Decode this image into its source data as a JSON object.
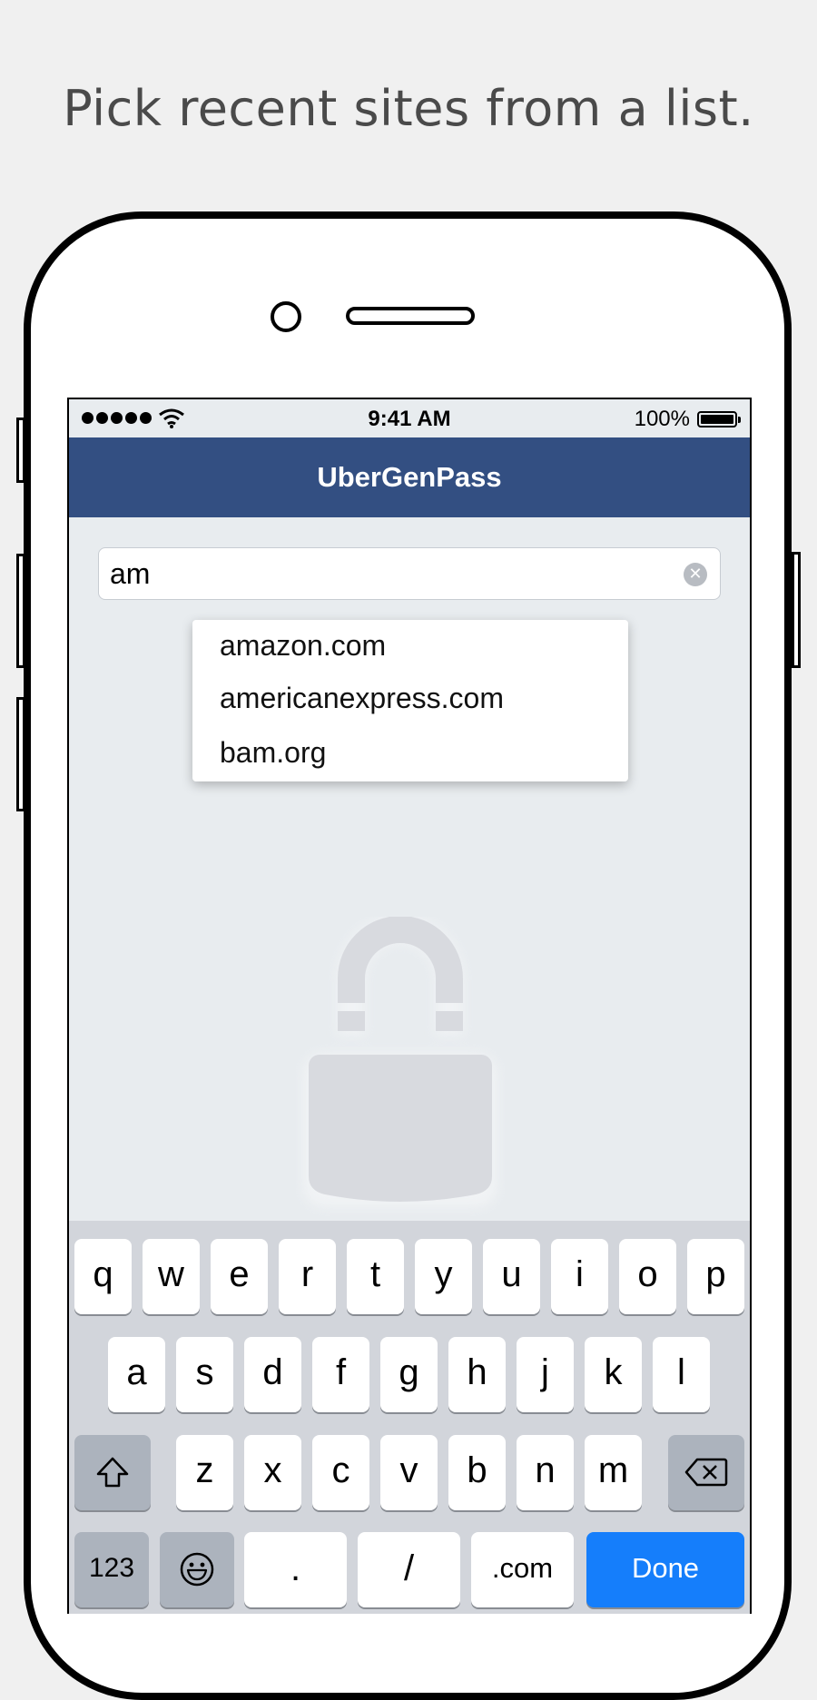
{
  "headline": "Pick recent sites from a list.",
  "status_bar": {
    "time": "9:41 AM",
    "battery_percent": "100%",
    "signal_bars": 5
  },
  "app": {
    "title": "UberGenPass"
  },
  "search": {
    "value": "am",
    "clear_icon": "clear-circle-icon"
  },
  "suggestions": [
    "amazon.com",
    "americanexpress.com",
    "bam.org"
  ],
  "background_icon": "lock-icon",
  "keyboard": {
    "row1": [
      "q",
      "w",
      "e",
      "r",
      "t",
      "y",
      "u",
      "i",
      "o",
      "p"
    ],
    "row2": [
      "a",
      "s",
      "d",
      "f",
      "g",
      "h",
      "j",
      "k",
      "l"
    ],
    "row3": [
      "z",
      "x",
      "c",
      "v",
      "b",
      "n",
      "m"
    ],
    "shift_icon": "shift-arrow-icon",
    "backspace_icon": "backspace-icon",
    "numbers_label": "123",
    "emoji_icon": "emoji-icon",
    "period_label": ".",
    "slash_label": "/",
    "dotcom_label": ".com",
    "done_label": "Done"
  },
  "colors": {
    "navbar": "#334f82",
    "done_key": "#157efb",
    "screen_bg": "#e8ecef",
    "keyboard_bg": "#d2d5db"
  }
}
